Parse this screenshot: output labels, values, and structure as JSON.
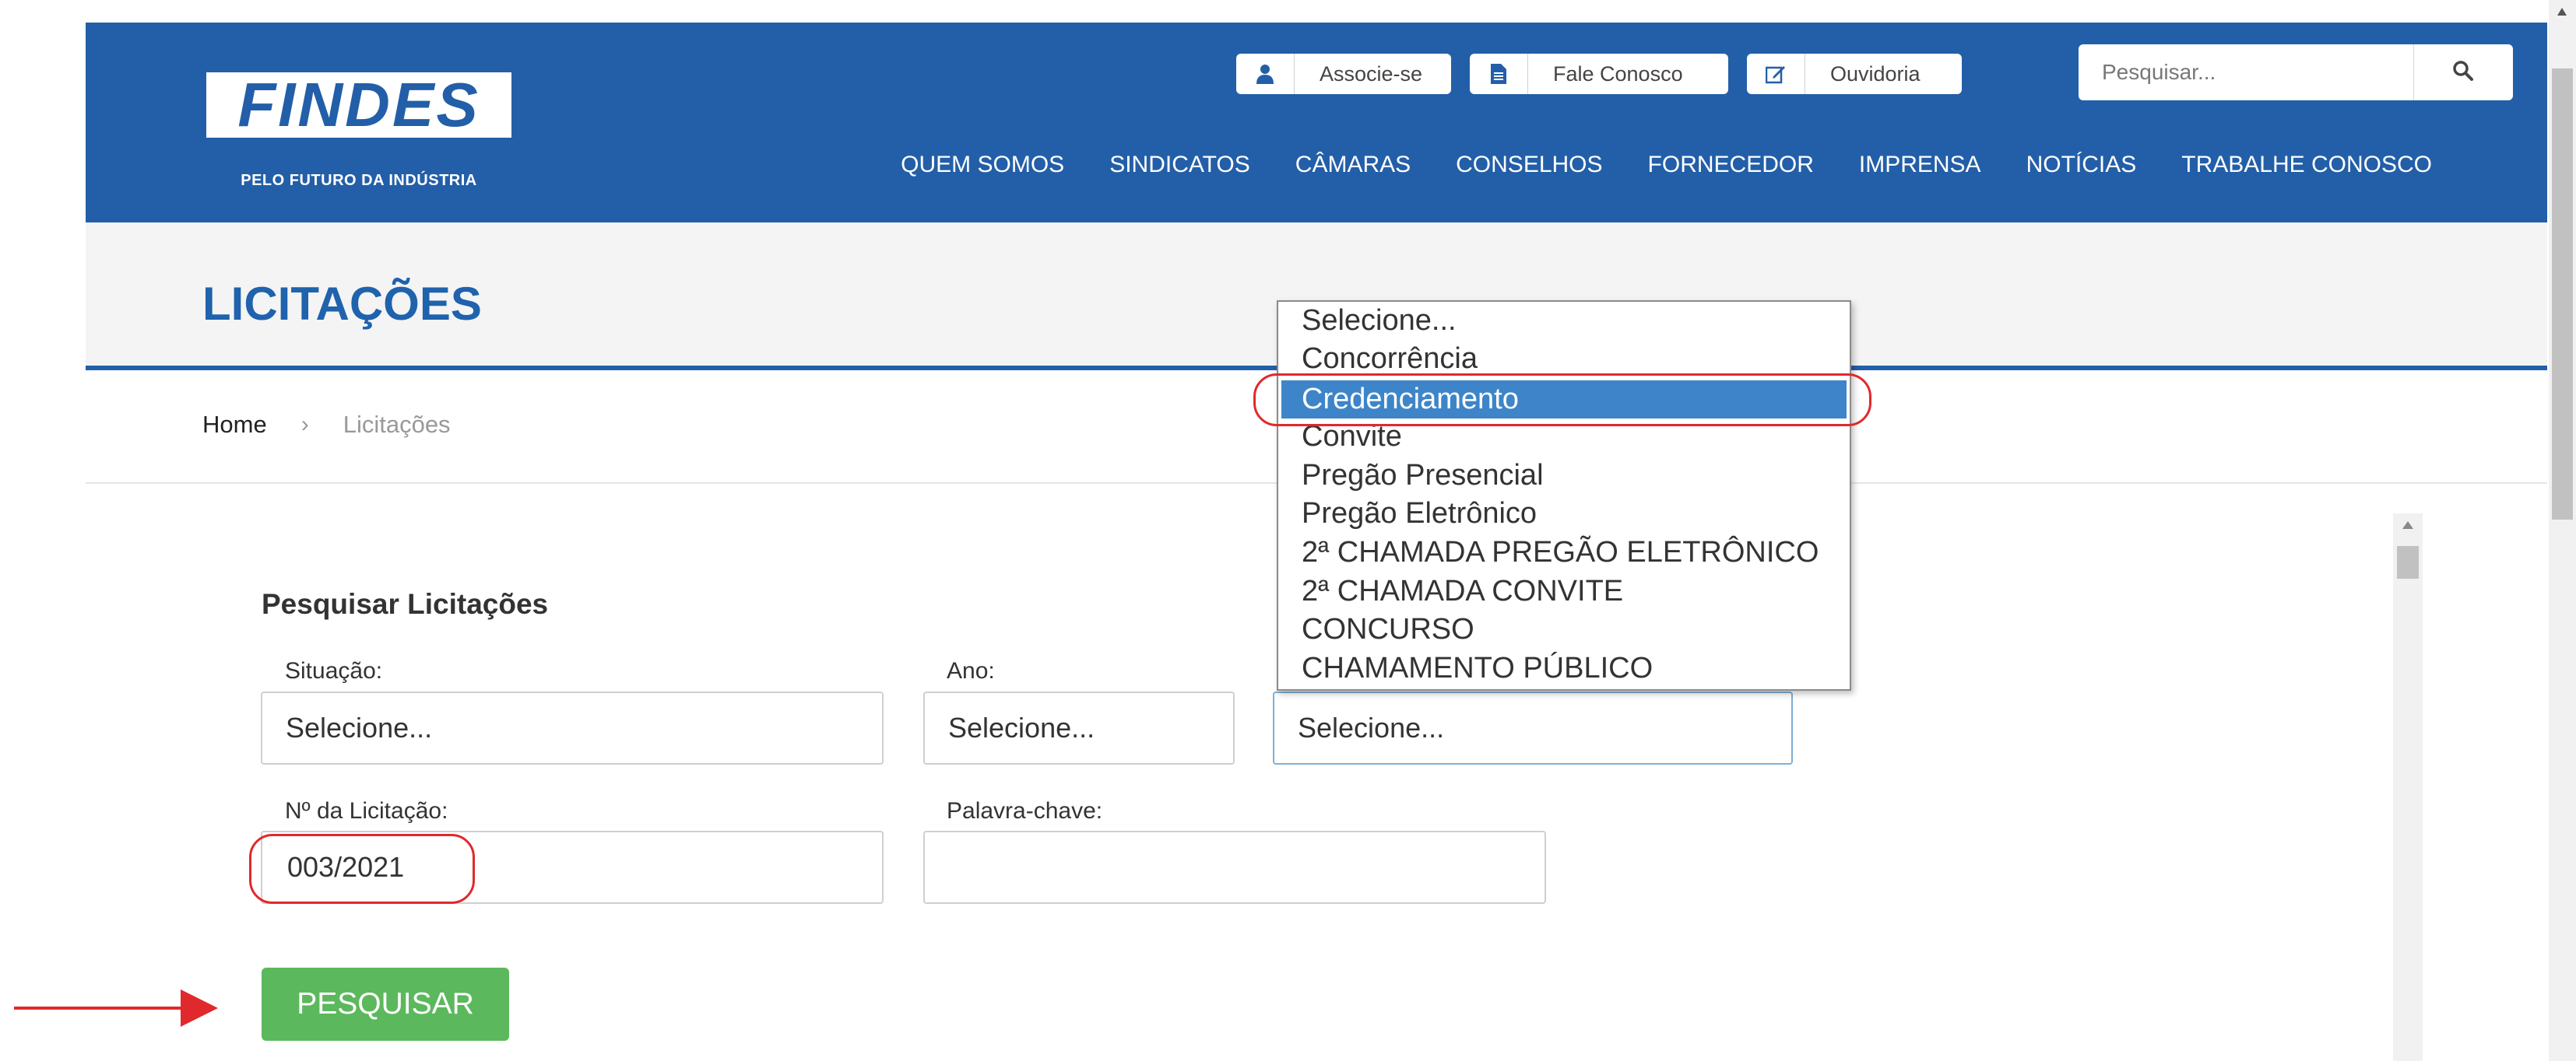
{
  "header": {
    "logo_text": "FINDES",
    "logo_tagline": "PELO FUTURO DA INDÚSTRIA",
    "top_buttons": [
      "Associe-se",
      "Fale Conosco",
      "Ouvidoria"
    ],
    "search_placeholder": "Pesquisar...",
    "nav": [
      "QUEM SOMOS",
      "SINDICATOS",
      "CÂMARAS",
      "CONSELHOS",
      "FORNECEDOR",
      "IMPRENSA",
      "NOTÍCIAS",
      "TRABALHE CONOSCO"
    ]
  },
  "page": {
    "title": "LICITAÇÕES",
    "breadcrumb": {
      "home": "Home",
      "separator": "›",
      "current": "Licitações"
    }
  },
  "form": {
    "title": "Pesquisar Licitações",
    "situacao_label": "Situação:",
    "situacao_value": "Selecione...",
    "ano_label": "Ano:",
    "ano_value": "Selecione...",
    "modalidade_value": "Selecione...",
    "numero_label": "Nº da Licitação:",
    "numero_value": "003/2021",
    "palavra_label": "Palavra-chave:",
    "palavra_value": "",
    "submit_label": "PESQUISAR"
  },
  "dropdown": {
    "selected": "Credenciamento",
    "options": [
      "Selecione...",
      "Concorrência",
      "Credenciamento",
      "Convite",
      "Pregão Presencial",
      "Pregão Eletrônico",
      "2ª CHAMADA PREGÃO ELETRÔNICO",
      "2ª CHAMADA CONVITE",
      "CONCURSO",
      "CHAMAMENTO PÚBLICO"
    ]
  },
  "colors": {
    "brand_blue": "#235fa8",
    "title_blue": "#1f62ad",
    "button_green": "#5cb85c",
    "selection_blue": "#3d85c8",
    "annotation_red": "#e0292c"
  },
  "icons": [
    "user-icon",
    "document-icon",
    "edit-icon",
    "search-icon"
  ]
}
